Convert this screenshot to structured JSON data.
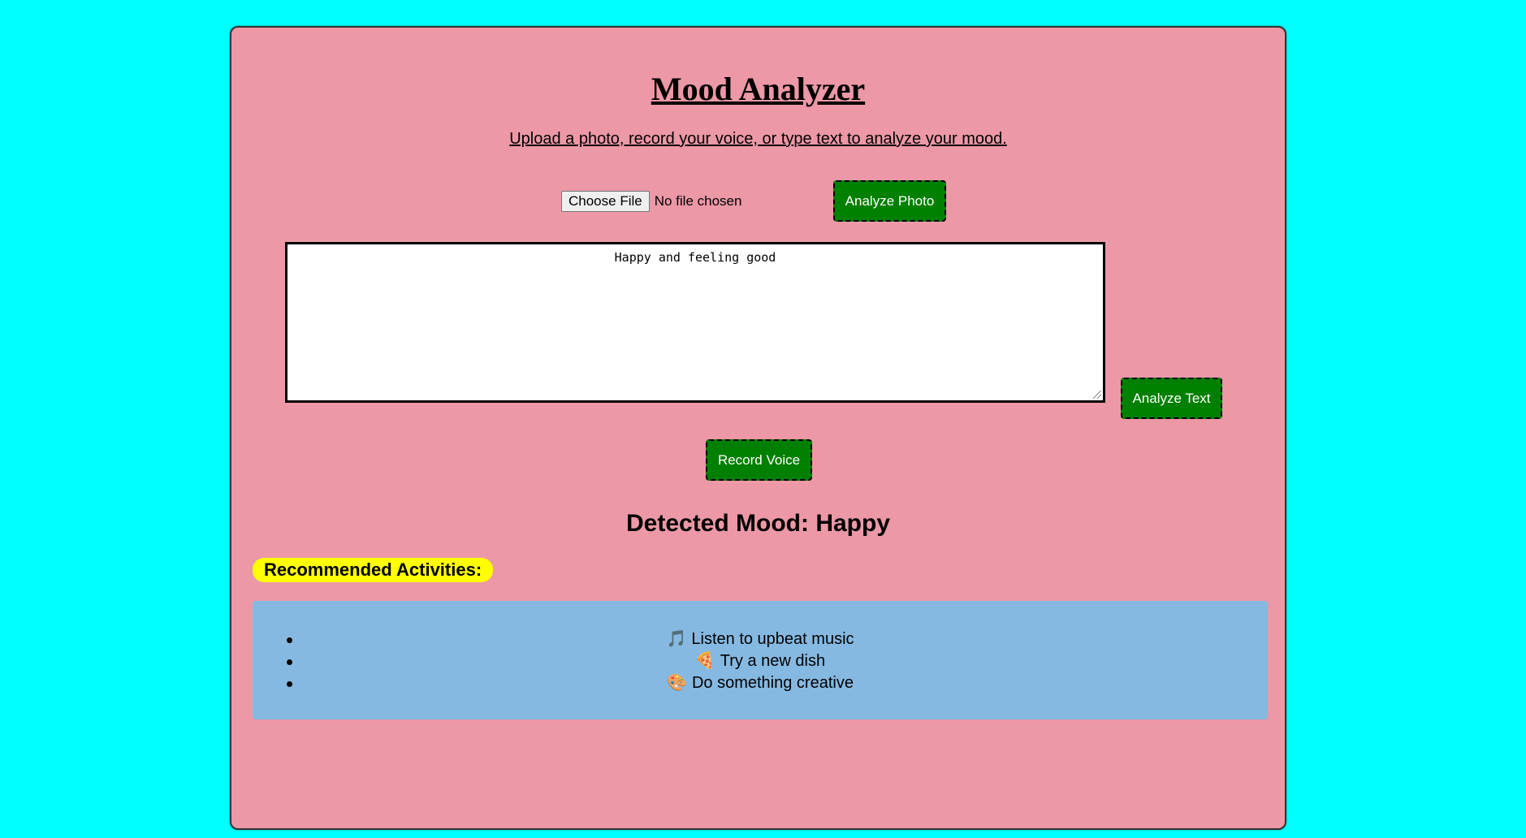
{
  "header": {
    "title": "Mood Analyzer",
    "subtitle": "Upload a photo, record your voice, or type text to analyze your mood."
  },
  "photo": {
    "choose_file_label": "Choose File",
    "file_status": "No file chosen",
    "analyze_label": "Analyze Photo"
  },
  "text_input": {
    "value": "Happy and feeling good",
    "analyze_label": "Analyze Text"
  },
  "voice": {
    "record_label": "Record Voice"
  },
  "result": {
    "detected_mood": "Detected Mood: Happy"
  },
  "recommendations": {
    "heading": "Recommended Activities:",
    "items": [
      {
        "icon": "music-note-icon",
        "glyph": "🎵",
        "label": "Listen to upbeat music"
      },
      {
        "icon": "pizza-icon",
        "glyph": "🍕",
        "label": "Try a new dish"
      },
      {
        "icon": "palette-icon",
        "glyph": "🎨",
        "label": "Do something creative"
      }
    ]
  },
  "colors": {
    "page_background": "#00ffff",
    "card_background": "#ec98a6",
    "button_green": "#008000",
    "heading_highlight": "#ffff00",
    "activities_background": "#86b9e1"
  }
}
